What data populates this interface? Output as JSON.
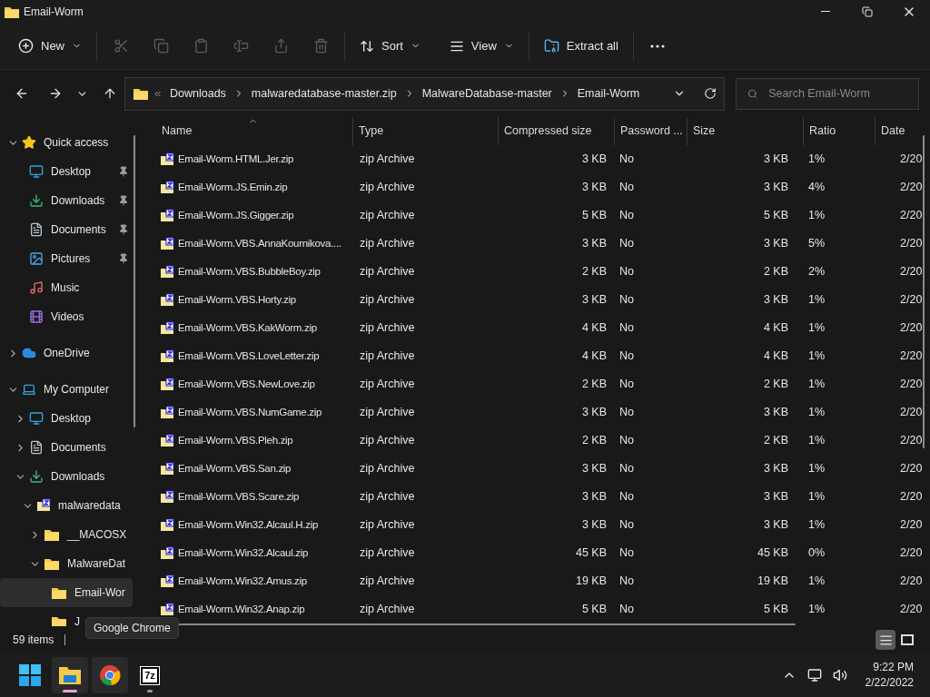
{
  "window": {
    "title": "Email-Worm"
  },
  "toolbar": {
    "new": "New",
    "sort": "Sort",
    "view": "View",
    "extract": "Extract all"
  },
  "address": {
    "path": [
      "Downloads",
      "malwaredatabase-master.zip",
      "MalwareDatabase-master",
      "Email-Worm"
    ],
    "search_placeholder": "Search Email-Worm"
  },
  "sidebar": [
    {
      "label": "Quick access",
      "kind": "star",
      "expanded": true,
      "selected": false,
      "children": [
        {
          "label": "Desktop",
          "kind": "desktop",
          "pinned": true,
          "selected": false
        },
        {
          "label": "Downloads",
          "kind": "download",
          "pinned": true,
          "selected": false
        },
        {
          "label": "Documents",
          "kind": "document",
          "pinned": true,
          "selected": false
        },
        {
          "label": "Pictures",
          "kind": "picture",
          "pinned": true,
          "selected": false
        },
        {
          "label": "Music",
          "kind": "music",
          "pinned": false,
          "selected": false
        },
        {
          "label": "Videos",
          "kind": "video",
          "pinned": false,
          "selected": false
        }
      ]
    },
    {
      "label": "OneDrive",
      "kind": "cloud",
      "expanded": false,
      "selected": false
    },
    {
      "label": "My Computer",
      "kind": "computer",
      "expanded": true,
      "selected": false,
      "children": [
        {
          "label": "Desktop",
          "kind": "desktop",
          "expanded": false,
          "selected": false
        },
        {
          "label": "Documents",
          "kind": "document",
          "expanded": false,
          "selected": false
        },
        {
          "label": "Downloads",
          "kind": "download",
          "expanded": true,
          "selected": false,
          "children": [
            {
              "label": "malwaredata",
              "kind": "zip",
              "expanded": true,
              "selected": false,
              "children": [
                {
                  "label": "__MACOSX",
                  "kind": "folder",
                  "expanded": false,
                  "selected": false
                },
                {
                  "label": "MalwareDat",
                  "kind": "folder",
                  "expanded": true,
                  "selected": false,
                  "children": [
                    {
                      "label": "Email-Wor",
                      "kind": "folder",
                      "selected": true
                    },
                    {
                      "label": "J",
                      "kind": "folder",
                      "selected": false
                    }
                  ]
                }
              ]
            }
          ]
        }
      ]
    }
  ],
  "table": {
    "columns": [
      {
        "label": "Name",
        "sorted": true
      },
      {
        "label": "Type",
        "sorted": false
      },
      {
        "label": "Compressed size",
        "sorted": false
      },
      {
        "label": "Password ...",
        "sorted": false
      },
      {
        "label": "Size",
        "sorted": false
      },
      {
        "label": "Ratio",
        "sorted": false
      },
      {
        "label": "Date",
        "sorted": false
      }
    ],
    "rows": [
      {
        "name": "Email-Worm.HTML.Jer.zip",
        "type": "zip Archive",
        "compressed": "3 KB",
        "password": "No",
        "size": "3 KB",
        "ratio": "1%",
        "date": "2/20"
      },
      {
        "name": "Email-Worm.JS.Emin.zip",
        "type": "zip Archive",
        "compressed": "3 KB",
        "password": "No",
        "size": "3 KB",
        "ratio": "4%",
        "date": "2/20"
      },
      {
        "name": "Email-Worm.JS.Gigger.zip",
        "type": "zip Archive",
        "compressed": "5 KB",
        "password": "No",
        "size": "5 KB",
        "ratio": "1%",
        "date": "2/20"
      },
      {
        "name": "Email-Worm.VBS.AnnaKournikova....",
        "type": "zip Archive",
        "compressed": "3 KB",
        "password": "No",
        "size": "3 KB",
        "ratio": "5%",
        "date": "2/20"
      },
      {
        "name": "Email-Worm.VBS.BubbleBoy.zip",
        "type": "zip Archive",
        "compressed": "2 KB",
        "password": "No",
        "size": "2 KB",
        "ratio": "2%",
        "date": "2/20"
      },
      {
        "name": "Email-Worm.VBS.Horty.zip",
        "type": "zip Archive",
        "compressed": "3 KB",
        "password": "No",
        "size": "3 KB",
        "ratio": "1%",
        "date": "2/20"
      },
      {
        "name": "Email-Worm.VBS.KakWorm.zip",
        "type": "zip Archive",
        "compressed": "4 KB",
        "password": "No",
        "size": "4 KB",
        "ratio": "1%",
        "date": "2/20"
      },
      {
        "name": "Email-Worm.VBS.LoveLetter.zip",
        "type": "zip Archive",
        "compressed": "4 KB",
        "password": "No",
        "size": "4 KB",
        "ratio": "1%",
        "date": "2/20"
      },
      {
        "name": "Email-Worm.VBS.NewLove.zip",
        "type": "zip Archive",
        "compressed": "2 KB",
        "password": "No",
        "size": "2 KB",
        "ratio": "1%",
        "date": "2/20"
      },
      {
        "name": "Email-Worm.VBS.NumGame.zip",
        "type": "zip Archive",
        "compressed": "3 KB",
        "password": "No",
        "size": "3 KB",
        "ratio": "1%",
        "date": "2/20"
      },
      {
        "name": "Email-Worm.VBS.Pleh.zip",
        "type": "zip Archive",
        "compressed": "2 KB",
        "password": "No",
        "size": "2 KB",
        "ratio": "1%",
        "date": "2/20"
      },
      {
        "name": "Email-Worm.VBS.San.zip",
        "type": "zip Archive",
        "compressed": "3 KB",
        "password": "No",
        "size": "3 KB",
        "ratio": "1%",
        "date": "2/20"
      },
      {
        "name": "Email-Worm.VBS.Scare.zip",
        "type": "zip Archive",
        "compressed": "3 KB",
        "password": "No",
        "size": "3 KB",
        "ratio": "1%",
        "date": "2/20"
      },
      {
        "name": "Email-Worm.Win32.Alcaul.H.zip",
        "type": "zip Archive",
        "compressed": "3 KB",
        "password": "No",
        "size": "3 KB",
        "ratio": "1%",
        "date": "2/20"
      },
      {
        "name": "Email-Worm.Win32.Alcaul.zip",
        "type": "zip Archive",
        "compressed": "45 KB",
        "password": "No",
        "size": "45 KB",
        "ratio": "0%",
        "date": "2/20"
      },
      {
        "name": "Email-Worm.Win32.Amus.zip",
        "type": "zip Archive",
        "compressed": "19 KB",
        "password": "No",
        "size": "19 KB",
        "ratio": "1%",
        "date": "2/20"
      },
      {
        "name": "Email-Worm.Win32.Anap.zip",
        "type": "zip Archive",
        "compressed": "5 KB",
        "password": "No",
        "size": "5 KB",
        "ratio": "1%",
        "date": "2/20"
      }
    ]
  },
  "status_bar": {
    "items": "59 items",
    "views": [
      {
        "kind": "details",
        "selected": true
      },
      {
        "kind": "tiles",
        "selected": false
      }
    ]
  },
  "tooltip": "Google Chrome",
  "taskbar": {
    "apps": [
      {
        "kind": "explorer",
        "running": true
      },
      {
        "kind": "chrome",
        "running": false
      },
      {
        "kind": "sevenzip",
        "glyph": "7z",
        "running": true
      }
    ],
    "time": "9:22 PM",
    "date": "2/22/2022"
  }
}
